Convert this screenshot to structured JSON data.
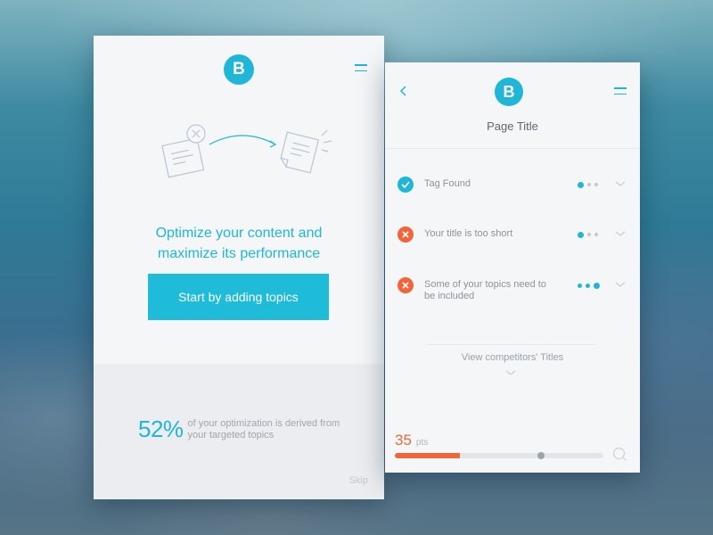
{
  "onboarding": {
    "logo_letter": "B",
    "headline_line1": "Optimize your content and",
    "headline_line2": "maximize its performance",
    "cta_label": "Start by adding topics",
    "stat_percent": "52%",
    "stat_text": "of your optimization is derived from your targeted topics",
    "skip_label": "Skip"
  },
  "analysis": {
    "logo_letter": "B",
    "page_title": "Page Title",
    "checks": [
      {
        "label": "Tag Found",
        "status": "ok",
        "icon": "check-icon",
        "level": 1
      },
      {
        "label": "Your title is too short",
        "status": "error",
        "icon": "close-icon",
        "level": 1
      },
      {
        "label": "Some of your topics need to be included",
        "status": "error",
        "icon": "close-icon",
        "level": 3
      }
    ],
    "view_competitors_label": "View competitors' Titles",
    "score_value": "35",
    "score_unit": "pts",
    "score_progress": 0.31,
    "score_marker": 0.7
  },
  "colors": {
    "accent": "#1fb6d8",
    "error": "#f0663a",
    "muted_text": "#8d949b"
  }
}
